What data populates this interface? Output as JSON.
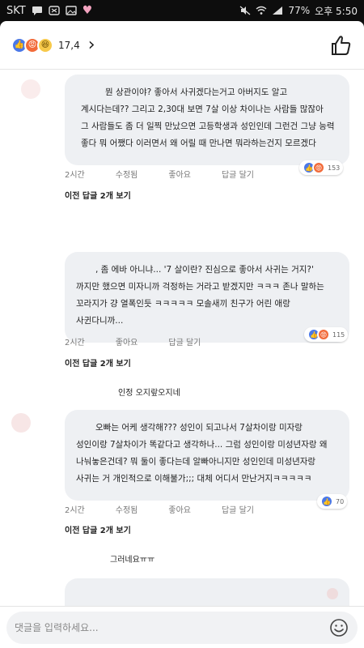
{
  "status": {
    "carrier": "SKT",
    "battery": "77%",
    "time": "오후 5:50"
  },
  "topbar": {
    "reaction_count": "17,4"
  },
  "comments": [
    {
      "text_lines": [
        "뭔 상관이야? 좋아서 사귀겠다는거고 아버지도 알고",
        "계시다는데?? 그리고 2,30대 보면 7살 이상 차이나는 사람들 많잖아",
        "그 사람들도 좀 더 일찍 만났으면 고등학생과 성인인데 그런건 그냥 능력",
        "좋다 뭐 어쨌다 이러면서 왜 어릴 때 만나면 뭐라하는건지 모르겠다"
      ],
      "meta": {
        "time": "2시간",
        "edit": "수정됨",
        "like": "좋아요",
        "reply": "답글 달기"
      },
      "reaction_count": "153",
      "prev_replies": "이전 답글 2개 보기"
    },
    {
      "text_lines": [
        ", 좀 에바 아니냐... '7 살이란? 진심으로 좋아서 사귀는 거지?'",
        "까지만 했으면 미자니까 걱정하는 거라고 받겠지만 ㅋㅋㅋ 존나 말하는",
        "꼬라지가 걍 열폭인듯 ㅋㅋㅋㅋㅋ 모솔새끼 친구가 어린 애랑",
        "사귄다니까..."
      ],
      "meta": {
        "time": "2시간",
        "like": "좋아요",
        "reply": "답글 달기"
      },
      "reaction_count": "115",
      "prev_replies": "이전 답글 2개 보기"
    },
    {
      "text_lines": [
        "오빠는 어케 생각해??? 성인이 되고나서 7살차이랑 미자랑",
        "성인이랑 7살차이가 똑같다고 생각하나... 그럼 성인이랑 미성년자랑 왜",
        "나눠놓은건데? 뭐 둘이 좋다는데 알빠아니지만 성인인데 미성년자랑",
        "사귀는 거 개인적으로 이해불가;;; 대체 어디서 만난거지ㅋㅋㅋㅋㅋ"
      ],
      "meta": {
        "time": "2시간",
        "edit": "수정됨",
        "like": "좋아요",
        "reply": "답글 달기"
      },
      "reaction_count": "70",
      "prev_replies": "이전 답글 2개 보기"
    }
  ],
  "notes": {
    "note1": "인정 오지랖오지네",
    "note2": "그러네요ㅠㅠ"
  },
  "composer": {
    "placeholder": "댓글을 입력하세요..."
  }
}
